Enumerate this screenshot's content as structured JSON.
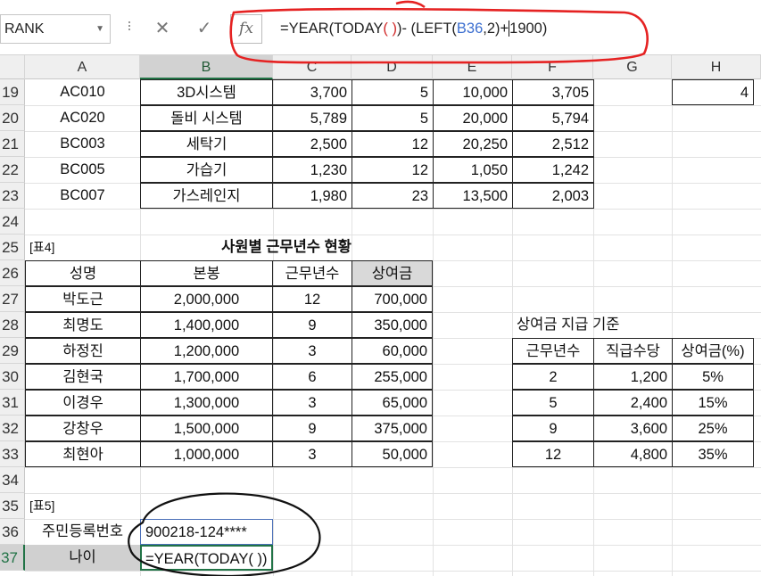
{
  "formula_bar": {
    "name_box": "RANK",
    "cancel_icon": "✕",
    "enter_icon": "✓",
    "fx_label": "fx",
    "formula_parts": [
      "=YEAR(TODAY",
      "( ",
      ")",
      ")- (LEFT(",
      "B36",
      ",2)+",
      "1900)"
    ]
  },
  "columns": [
    "A",
    "B",
    "C",
    "D",
    "E",
    "F",
    "G",
    "H"
  ],
  "rows": [
    "19",
    "20",
    "21",
    "22",
    "23",
    "24",
    "25",
    "26",
    "27",
    "28",
    "29",
    "30",
    "31",
    "32",
    "33",
    "34",
    "35",
    "36",
    "37"
  ],
  "top_table": [
    [
      "AC010",
      "3D시스템",
      "3,700",
      "5",
      "10,000",
      "3,705"
    ],
    [
      "AC020",
      "돌비 시스템",
      "5,789",
      "5",
      "20,000",
      "5,794"
    ],
    [
      "BC003",
      "세탁기",
      "2,500",
      "12",
      "20,250",
      "2,512"
    ],
    [
      "BC005",
      "가습기",
      "1,230",
      "12",
      "1,050",
      "1,242"
    ],
    [
      "BC007",
      "가스레인지",
      "1,980",
      "23",
      "13,500",
      "2,003"
    ]
  ],
  "h19": "4",
  "table4": {
    "tag": "[표4]",
    "title": "사원별 근무년수 현황",
    "headers": [
      "성명",
      "본봉",
      "근무년수",
      "상여금"
    ],
    "rows": [
      [
        "박도근",
        "2,000,000",
        "12",
        "700,000"
      ],
      [
        "최명도",
        "1,400,000",
        "9",
        "350,000"
      ],
      [
        "하정진",
        "1,200,000",
        "3",
        "60,000"
      ],
      [
        "김현국",
        "1,700,000",
        "6",
        "255,000"
      ],
      [
        "이경우",
        "1,300,000",
        "3",
        "65,000"
      ],
      [
        "강창우",
        "1,500,000",
        "9",
        "375,000"
      ],
      [
        "최현아",
        "1,000,000",
        "3",
        "50,000"
      ]
    ]
  },
  "bonus_criteria": {
    "title": "상여금 지급 기준",
    "headers": [
      "근무년수",
      "직급수당",
      "상여금(%)"
    ],
    "rows": [
      [
        "2",
        "1,200",
        "5%"
      ],
      [
        "5",
        "2,400",
        "15%"
      ],
      [
        "9",
        "3,600",
        "25%"
      ],
      [
        "12",
        "4,800",
        "35%"
      ]
    ]
  },
  "table5": {
    "tag": "[표5]",
    "label_id": "주민등록번호",
    "value_id": "900218-124****",
    "label_age": "나이",
    "editing": "=YEAR(TODAY( ))"
  }
}
